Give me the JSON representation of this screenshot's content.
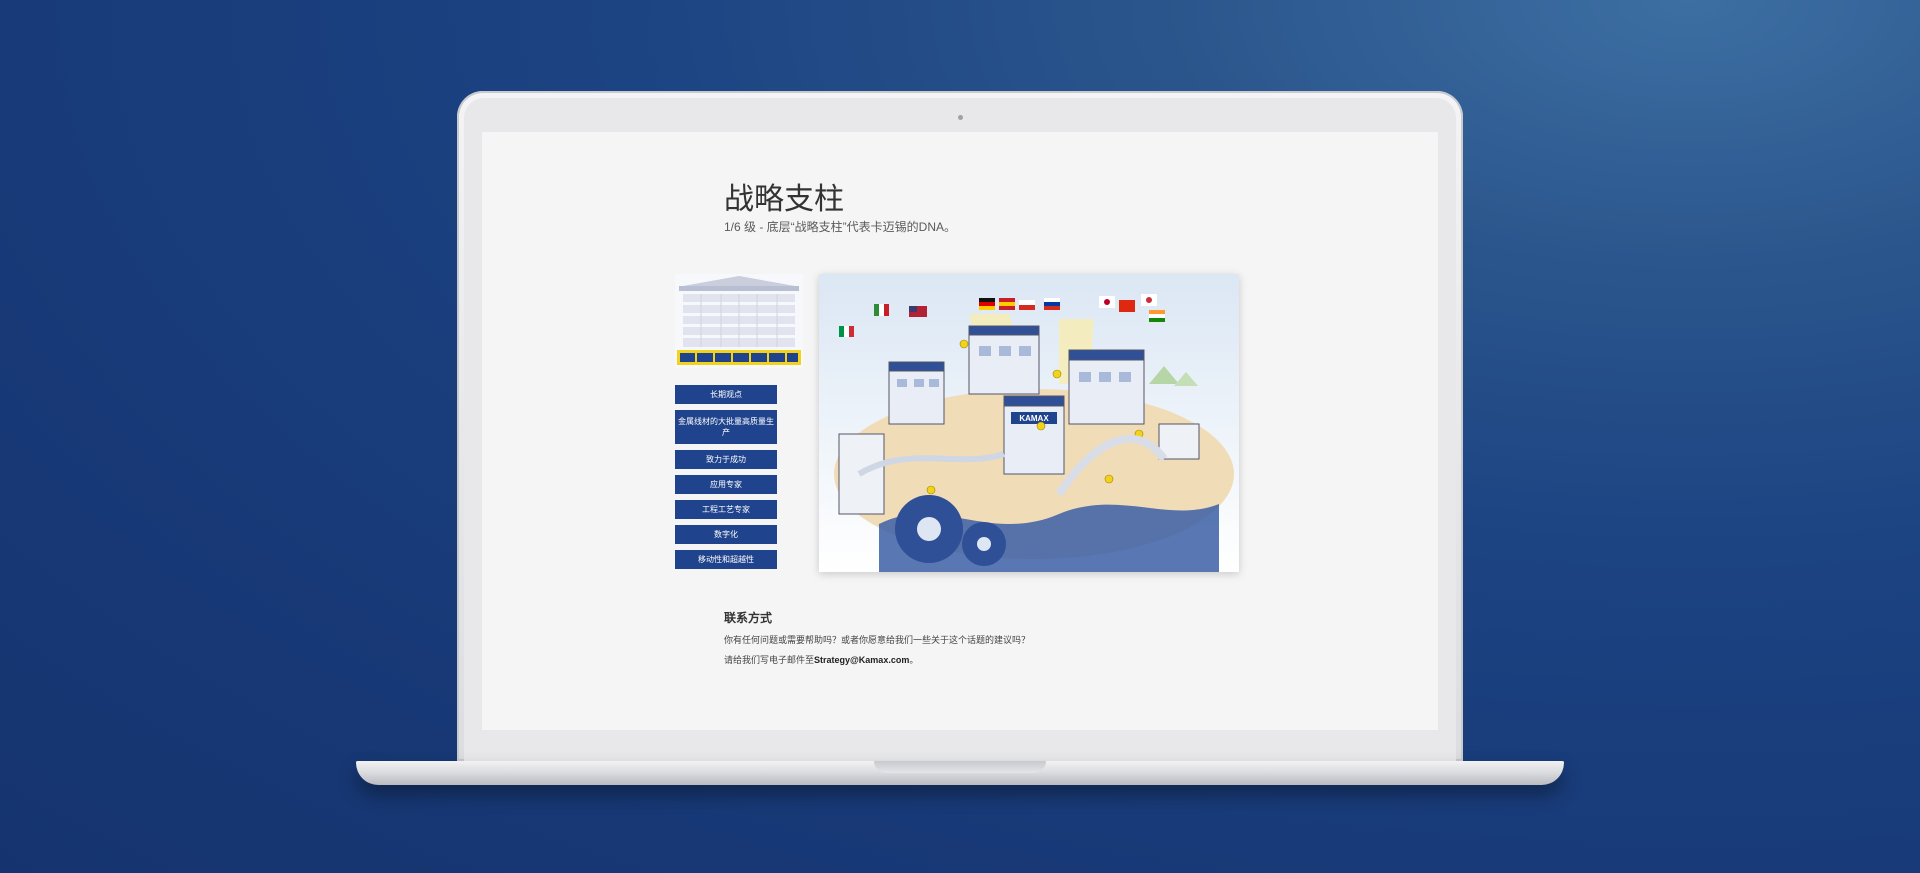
{
  "page": {
    "title": "战略支柱",
    "subtitle": "1/6 级 - 底层“战略支柱”代表卡迈锡的DNA。"
  },
  "side_nav": {
    "items": [
      {
        "label": "长期观点"
      },
      {
        "label": "金属线材的大批量高质量生产"
      },
      {
        "label": "致力于成功"
      },
      {
        "label": "应用专家"
      },
      {
        "label": "工程工艺专家"
      },
      {
        "label": "数字化"
      },
      {
        "label": "移动性和超越性"
      }
    ]
  },
  "illustration": {
    "brand_sign": "KAMAX"
  },
  "contact": {
    "heading": "联系方式",
    "question": "你有任何问题或需要帮助吗？或者你愿意给我们一些关于这个话题的建议吗？",
    "email_prefix": "请给我们写电子邮件至",
    "email": "Strategy@Kamax.com",
    "email_suffix": "。"
  },
  "colors": {
    "background": "#183a78",
    "button": "#1f438c",
    "highlight": "#f2d21b"
  }
}
